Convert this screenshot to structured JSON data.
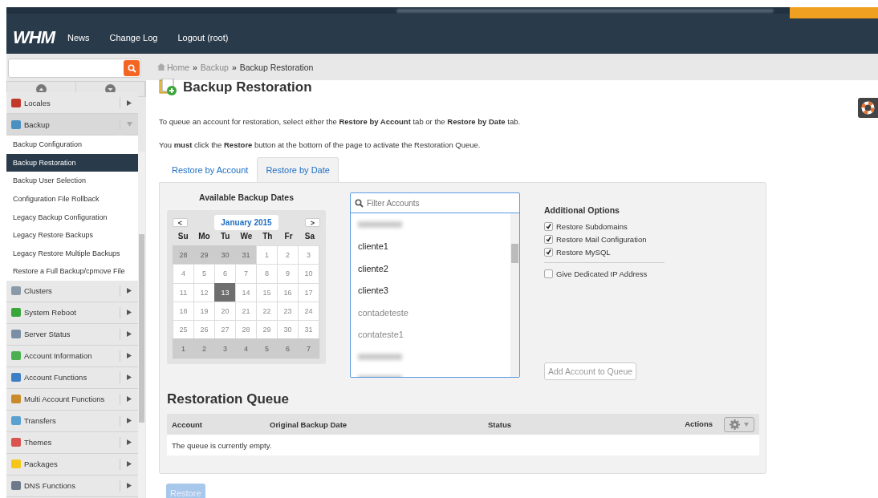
{
  "header": {
    "logo": "WHM",
    "nav": [
      "News",
      "Change Log",
      "Logout (root)"
    ]
  },
  "breadcrumb": {
    "items": [
      "Home",
      "Backup",
      "Backup Restoration"
    ],
    "separators": [
      "»",
      "»"
    ]
  },
  "sidebar": {
    "items": [
      {
        "kind": "section",
        "label": "Locales",
        "expanded": false,
        "color": "#c0392b"
      },
      {
        "kind": "section",
        "label": "Backup",
        "expanded": true,
        "color": "#4a90c0"
      },
      {
        "kind": "sub",
        "label": "Backup Configuration",
        "selected": false
      },
      {
        "kind": "sub",
        "label": "Backup Restoration",
        "selected": true
      },
      {
        "kind": "sub",
        "label": "Backup User Selection",
        "selected": false
      },
      {
        "kind": "sub",
        "label": "Configuration File Rollback",
        "selected": false
      },
      {
        "kind": "sub",
        "label": "Legacy Backup Configuration",
        "selected": false
      },
      {
        "kind": "sub",
        "label": "Legacy Restore Backups",
        "selected": false
      },
      {
        "kind": "sub",
        "label": "Legacy Restore Multiple Backups",
        "selected": false
      },
      {
        "kind": "sub",
        "label": "Restore a Full Backup/cpmove File",
        "selected": false
      },
      {
        "kind": "section",
        "label": "Clusters",
        "expanded": false,
        "color": "#8a9aa8"
      },
      {
        "kind": "section",
        "label": "System Reboot",
        "expanded": false,
        "color": "#3aa63a"
      },
      {
        "kind": "section",
        "label": "Server Status",
        "expanded": false,
        "color": "#7a8fa5"
      },
      {
        "kind": "section",
        "label": "Account Information",
        "expanded": false,
        "color": "#4caf50"
      },
      {
        "kind": "section",
        "label": "Account Functions",
        "expanded": false,
        "color": "#3d7fc4"
      },
      {
        "kind": "section",
        "label": "Multi Account Functions",
        "expanded": false,
        "color": "#c98a2a"
      },
      {
        "kind": "section",
        "label": "Transfers",
        "expanded": false,
        "color": "#5aa0d0"
      },
      {
        "kind": "section",
        "label": "Themes",
        "expanded": false,
        "color": "#d9534f"
      },
      {
        "kind": "section",
        "label": "Packages",
        "expanded": false,
        "color": "#f5c518"
      },
      {
        "kind": "section",
        "label": "DNS Functions",
        "expanded": false,
        "color": "#6c7a89"
      }
    ]
  },
  "page": {
    "title": "Backup Restoration",
    "intro": "To queue an account for restoration, select either the **Restore by Account** tab or the **Restore by Date** tab.",
    "note": "You **must** click the **Restore** button at the bottom of the page to activate the Restoration Queue.",
    "tabs": [
      {
        "label": "Restore by Account",
        "selected": false
      },
      {
        "label": "Restore by Date",
        "selected": true
      }
    ]
  },
  "calendar": {
    "heading": "Available Backup Dates",
    "prev": "<",
    "next": ">",
    "month": "January 2015",
    "weekdays": [
      "Su",
      "Mo",
      "Tu",
      "We",
      "Th",
      "Fr",
      "Sa"
    ],
    "weeks": [
      [
        {
          "day": "28",
          "outside": true,
          "selected": false
        },
        {
          "day": "29",
          "outside": true,
          "selected": false
        },
        {
          "day": "30",
          "outside": true,
          "selected": false
        },
        {
          "day": "31",
          "outside": true,
          "selected": false
        },
        {
          "day": "1",
          "outside": false,
          "selected": false
        },
        {
          "day": "2",
          "outside": false,
          "selected": false
        },
        {
          "day": "3",
          "outside": false,
          "selected": false
        }
      ],
      [
        {
          "day": "4",
          "outside": false,
          "selected": false
        },
        {
          "day": "5",
          "outside": false,
          "selected": false
        },
        {
          "day": "6",
          "outside": false,
          "selected": false
        },
        {
          "day": "7",
          "outside": false,
          "selected": false
        },
        {
          "day": "8",
          "outside": false,
          "selected": false
        },
        {
          "day": "9",
          "outside": false,
          "selected": false
        },
        {
          "day": "10",
          "outside": false,
          "selected": false
        }
      ],
      [
        {
          "day": "11",
          "outside": false,
          "selected": false
        },
        {
          "day": "12",
          "outside": false,
          "selected": false
        },
        {
          "day": "13",
          "outside": false,
          "selected": true
        },
        {
          "day": "14",
          "outside": false,
          "selected": false
        },
        {
          "day": "15",
          "outside": false,
          "selected": false
        },
        {
          "day": "16",
          "outside": false,
          "selected": false
        },
        {
          "day": "17",
          "outside": false,
          "selected": false
        }
      ],
      [
        {
          "day": "18",
          "outside": false,
          "selected": false
        },
        {
          "day": "19",
          "outside": false,
          "selected": false
        },
        {
          "day": "20",
          "outside": false,
          "selected": false
        },
        {
          "day": "21",
          "outside": false,
          "selected": false
        },
        {
          "day": "22",
          "outside": false,
          "selected": false
        },
        {
          "day": "23",
          "outside": false,
          "selected": false
        },
        {
          "day": "24",
          "outside": false,
          "selected": false
        }
      ],
      [
        {
          "day": "25",
          "outside": false,
          "selected": false
        },
        {
          "day": "26",
          "outside": false,
          "selected": false
        },
        {
          "day": "27",
          "outside": false,
          "selected": false
        },
        {
          "day": "28",
          "outside": false,
          "selected": false
        },
        {
          "day": "29",
          "outside": false,
          "selected": false
        },
        {
          "day": "30",
          "outside": false,
          "selected": false
        },
        {
          "day": "31",
          "outside": false,
          "selected": false
        }
      ],
      [
        {
          "day": "1",
          "outside": true,
          "selected": false
        },
        {
          "day": "2",
          "outside": true,
          "selected": false
        },
        {
          "day": "3",
          "outside": true,
          "selected": false
        },
        {
          "day": "4",
          "outside": true,
          "selected": false
        },
        {
          "day": "5",
          "outside": true,
          "selected": false
        },
        {
          "day": "6",
          "outside": true,
          "selected": false
        },
        {
          "day": "7",
          "outside": true,
          "selected": false
        }
      ]
    ]
  },
  "accounts": {
    "placeholder": "Filter Accounts",
    "items": [
      {
        "kind": "blurred"
      },
      {
        "kind": "account",
        "name": "cliente1",
        "available": true
      },
      {
        "kind": "account",
        "name": "cliente2",
        "available": true
      },
      {
        "kind": "account",
        "name": "cliente3",
        "available": true
      },
      {
        "kind": "account",
        "name": "contadeteste",
        "available": false
      },
      {
        "kind": "account",
        "name": "contateste1",
        "available": false
      },
      {
        "kind": "blurred"
      },
      {
        "kind": "blurred"
      }
    ]
  },
  "options": {
    "heading": "Additional Options",
    "items": [
      {
        "label": "Restore Subdomains",
        "checked": true
      },
      {
        "label": "Restore Mail Configuration",
        "checked": true
      },
      {
        "label": "Restore MySQL",
        "checked": true
      },
      {
        "label": "Give Dedicated IP Address",
        "checked": false
      }
    ],
    "add_button": "Add Account to Queue"
  },
  "queue": {
    "heading": "Restoration Queue",
    "columns": [
      "Account",
      "Original Backup Date",
      "Status",
      "Actions"
    ],
    "empty": "The queue is currently empty."
  },
  "restore_button": "Restore"
}
